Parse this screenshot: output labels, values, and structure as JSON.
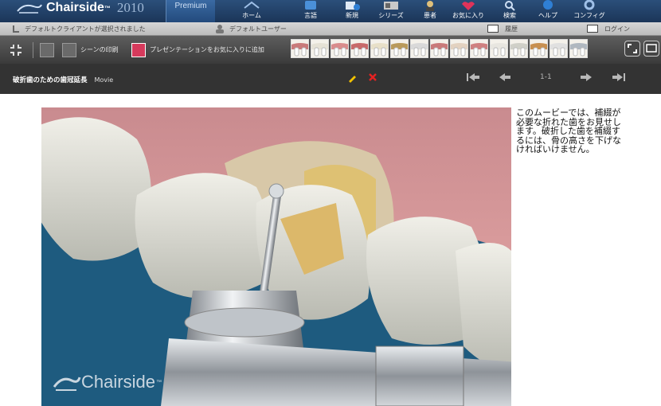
{
  "app": {
    "name": "Chairside",
    "year": "2010",
    "edition": "Premium"
  },
  "nav": [
    {
      "label": "ホーム",
      "icon": "home-icon"
    },
    {
      "label": "言語",
      "icon": "language-icon"
    },
    {
      "label": "新規",
      "icon": "new-icon"
    },
    {
      "label": "シリーズ",
      "icon": "series-icon"
    },
    {
      "label": "患者",
      "icon": "patient-icon"
    },
    {
      "label": "お気に入り",
      "icon": "favorites-icon"
    },
    {
      "label": "検索",
      "icon": "search-icon"
    },
    {
      "label": "ヘルプ",
      "icon": "help-icon"
    },
    {
      "label": "コンフィグ",
      "icon": "config-icon"
    }
  ],
  "status": {
    "client": "デフォルトクライアントが選択されました",
    "user": "デフォルトユーザー",
    "history": "履歴",
    "login": "ログイン"
  },
  "actions": {
    "print_scene": "シーンの印刷",
    "add_favorite": "プレゼンテーションをお気に入りに追加"
  },
  "thumbnails": [
    "scene-1",
    "scene-2",
    "scene-3",
    "scene-4",
    "scene-5",
    "scene-6",
    "scene-7",
    "scene-8",
    "scene-9",
    "scene-10",
    "scene-11",
    "scene-12",
    "scene-13",
    "scene-14",
    "scene-15"
  ],
  "movie": {
    "title": "破折歯のための歯冠延長",
    "type": "Movie",
    "page": "1-1",
    "watermark": "Chairside",
    "watermark_tm": "™",
    "description": "このムービーでは、補綴が必要な折れた歯をお見せします。破折した歯を補綴するには、骨の高さを下げなければいけません。"
  },
  "colors": {
    "topbar": "#1f3d63",
    "actionbar": "#4a4a4a",
    "titlebar": "#333333",
    "accent_edit": "#f2c200",
    "accent_close": "#e52222"
  }
}
